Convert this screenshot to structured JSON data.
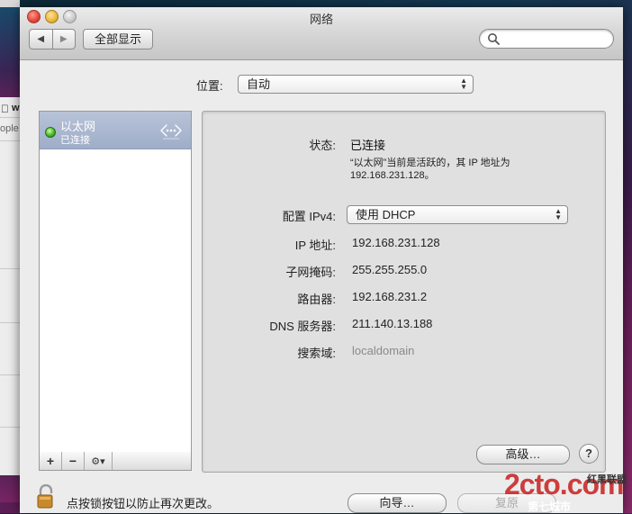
{
  "background": {
    "row1": "w",
    "row2": "ople"
  },
  "window": {
    "title": "网络"
  },
  "toolbar": {
    "back_glyph": "◀",
    "forward_glyph": "▶",
    "show_all": "全部显示",
    "search_placeholder": ""
  },
  "location": {
    "label": "位置:",
    "value": "自动"
  },
  "services": [
    {
      "name": "以太网",
      "status": "已连接",
      "status_color": "#3ab424",
      "icon": "ethernet-icon"
    }
  ],
  "service_toolbar": {
    "add": "+",
    "remove": "−",
    "gear": "⚙▾"
  },
  "detail": {
    "status_label": "状态:",
    "status_value": "已连接",
    "status_desc_line1": "“以太网”当前是活跃的，其 IP 地址为",
    "status_desc_line2": "192.168.231.128。",
    "config_label": "配置 IPv4:",
    "config_value": "使用 DHCP",
    "ip_label": "IP 地址:",
    "ip_value": "192.168.231.128",
    "subnet_label": "子网掩码:",
    "subnet_value": "255.255.255.0",
    "router_label": "路由器:",
    "router_value": "192.168.231.2",
    "dns_label": "DNS 服务器:",
    "dns_value": "211.140.13.188",
    "search_domain_label": "搜索域:",
    "search_domain_value": "localdomain",
    "advanced": "高级…",
    "help": "?"
  },
  "footer": {
    "lock_text": "点按锁按钮以防止再次更改。",
    "assist": "向导…",
    "revert": "复原"
  },
  "watermark": {
    "logo": "2cto.com",
    "line1": "红黑联盟",
    "line2": "第七城市"
  }
}
